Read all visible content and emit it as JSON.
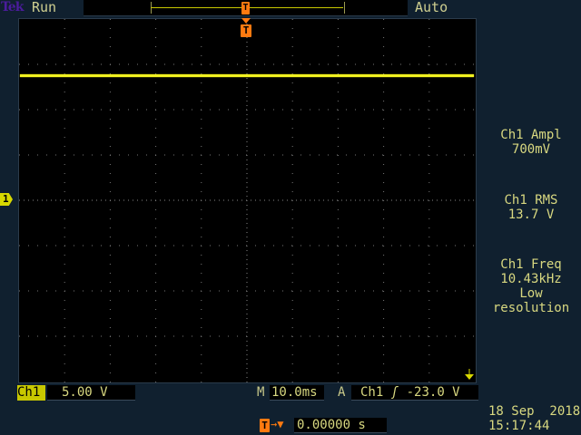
{
  "header": {
    "brand": "Tek",
    "acq_state": "Run",
    "trigger_mode": "Auto"
  },
  "channel": {
    "label": "Ch1",
    "marker": "1",
    "scale": "5.00 V"
  },
  "timebase": {
    "prefix": "M",
    "value": "10.0ms"
  },
  "trigger": {
    "prefix": "A",
    "source": "Ch1",
    "slope_icon": "rising-edge",
    "slope": "ʃ",
    "level": "-23.0 V",
    "marker": "T"
  },
  "position": {
    "value": "0.00000 s",
    "arrow": "→▼"
  },
  "measurements": [
    {
      "label": "Ch1 Ampl",
      "value": "700mV"
    },
    {
      "label": "Ch1 RMS",
      "value": "13.7 V"
    },
    {
      "label": "Ch1 Freq",
      "value": "10.43kHz",
      "note1": "Low",
      "note2": "resolution"
    }
  ],
  "datetime": {
    "date": "18 Sep  2018",
    "time": "15:17:44"
  },
  "colors": {
    "trace": "#f0f020",
    "trigger": "#ff7a10",
    "background": "#10202f"
  }
}
